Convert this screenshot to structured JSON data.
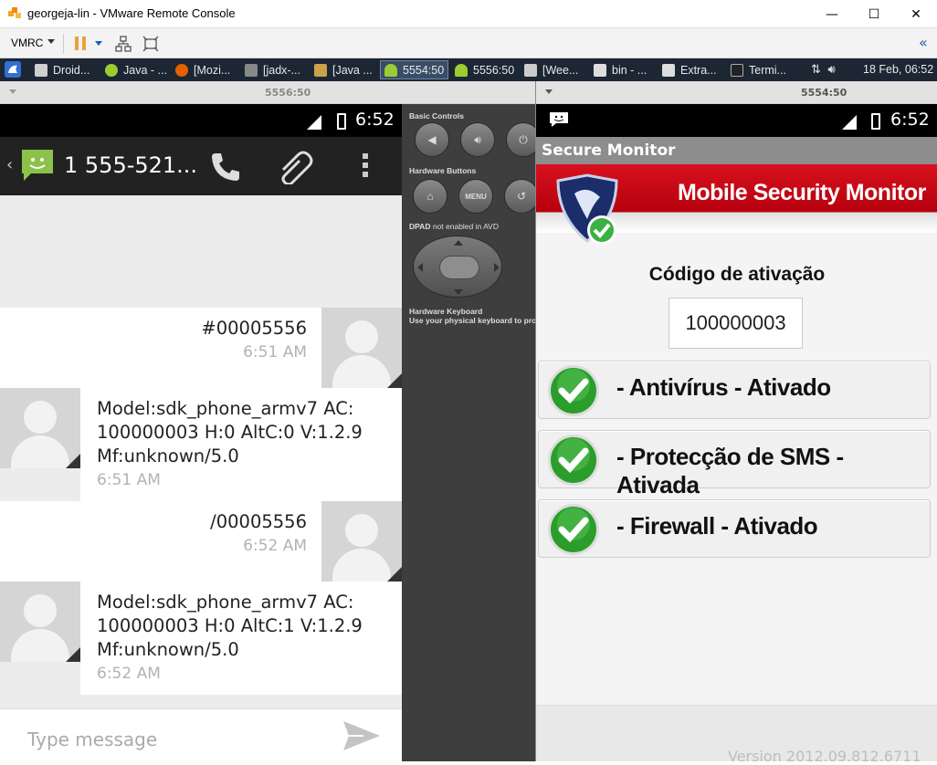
{
  "window": {
    "title": "georgeja-lin - VMware Remote Console",
    "minimize": "—",
    "maximize": "☐",
    "close": "✕"
  },
  "toolbar": {
    "vmrc_label": "VMRC",
    "collapse": "«"
  },
  "taskbar": {
    "tasks": [
      {
        "label": "Droid...",
        "color": "#cfcfcf"
      },
      {
        "label": "Java - ...",
        "color": "#9acd32"
      },
      {
        "label": "[Mozi...",
        "color": "#e66000"
      },
      {
        "label": "[jadx-...",
        "color": "#888888"
      },
      {
        "label": "[Java ...",
        "color": "#c9a24a"
      },
      {
        "label": "5554:50",
        "color": "#9acd32"
      },
      {
        "label": "5556:50",
        "color": "#9acd32"
      },
      {
        "label": "[Wee...",
        "color": "#cccccc"
      },
      {
        "label": "bin - ...",
        "color": "#dddddd"
      },
      {
        "label": "Extra...",
        "color": "#dddddd"
      },
      {
        "label": "Termi...",
        "color": "#222222"
      }
    ],
    "clock": "18 Feb, 06:52"
  },
  "left_emulator": {
    "frame_title": "5556:50",
    "status_time": "6:52",
    "contact": "1 555-521...",
    "messages": [
      {
        "side": "out",
        "text": "#00005556",
        "time": "6:51 AM"
      },
      {
        "side": "in",
        "lines": [
          "Model:sdk_phone_armv7 AC:",
          "100000003 H:0 AltC:0 V:1.2.9",
          "Mf:unknown/5.0"
        ],
        "time": "6:51 AM"
      },
      {
        "side": "out",
        "text": "/00005556",
        "time": "6:52 AM"
      },
      {
        "side": "in",
        "lines": [
          "Model:sdk_phone_armv7 AC:",
          "100000003 H:0 AltC:1 V:1.2.9",
          "Mf:unknown/5.0"
        ],
        "time": "6:52 AM"
      }
    ],
    "composer_placeholder": "Type message"
  },
  "controls": {
    "basic": "Basic Controls",
    "hardware_buttons": "Hardware Buttons",
    "menu": "MENU",
    "dpad_bold": "DPAD",
    "dpad_rest": " not enabled in AVD",
    "keyboard_title": "Hardware Keyboard",
    "keyboard_desc": "Use your physical keyboard to pro"
  },
  "right_emulator": {
    "frame_title": "5554:50",
    "status_time": "6:52",
    "app_title": "Secure Monitor",
    "banner_title": "Mobile Security Monitor",
    "activation_label": "Código de ativação",
    "activation_code": "100000003",
    "statuses": [
      "- Antivírus - Ativado",
      "- Protecção de SMS - Ativada",
      "- Firewall - Ativado"
    ],
    "version": "Version 2012.09.812.6711"
  },
  "colors": {
    "banner_red": "#d8111e",
    "check_green": "#2a9d2a",
    "active_task": "#3a4d66"
  }
}
